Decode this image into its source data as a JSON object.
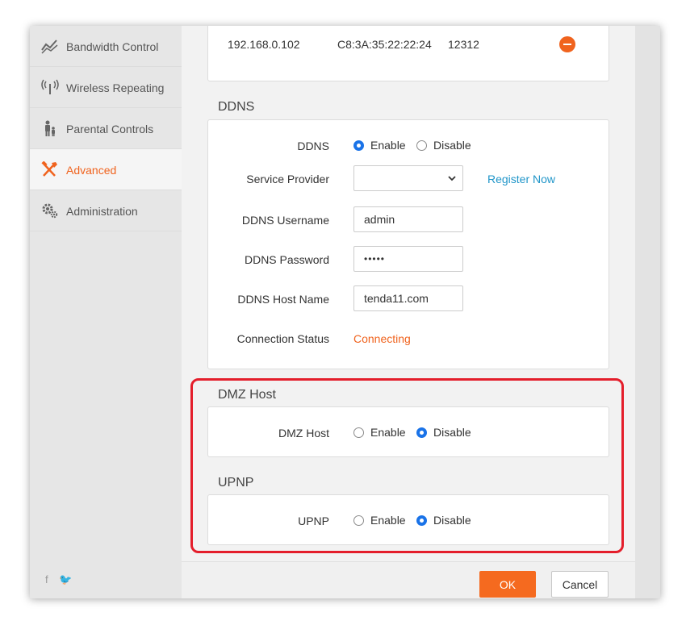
{
  "sidebar": {
    "items": [
      {
        "label": "Bandwidth Control",
        "icon": "chart-line-icon"
      },
      {
        "label": "Wireless Repeating",
        "icon": "wireless-signal-icon"
      },
      {
        "label": "Parental Controls",
        "icon": "parent-child-icon"
      },
      {
        "label": "Advanced",
        "icon": "tools-icon",
        "active": true
      },
      {
        "label": "Administration",
        "icon": "gears-icon"
      }
    ],
    "social": "f 🐦"
  },
  "top_table": {
    "row": {
      "ip": "192.168.0.102",
      "mac": "C8:3A:35:22:22:24",
      "port": "12312",
      "action_icon": "remove-icon"
    }
  },
  "ddns": {
    "title": "DDNS",
    "ddns_label": "DDNS",
    "enable_label": "Enable",
    "disable_label": "Disable",
    "enabled": true,
    "service_provider_label": "Service Provider",
    "service_provider_value": "",
    "register_link": "Register Now",
    "username_label": "DDNS Username",
    "username_value": "admin",
    "password_label": "DDNS Password",
    "password_value": "•••••",
    "host_label": "DDNS Host Name",
    "host_value": "tenda11.com",
    "status_label": "Connection Status",
    "status_value": "Connecting"
  },
  "dmz": {
    "title": "DMZ Host",
    "label": "DMZ Host",
    "enable_label": "Enable",
    "disable_label": "Disable",
    "enabled": false
  },
  "upnp": {
    "title": "UPNP",
    "label": "UPNP",
    "enable_label": "Enable",
    "disable_label": "Disable",
    "enabled": false
  },
  "footer": {
    "ok_label": "OK",
    "cancel_label": "Cancel"
  },
  "colors": {
    "accent": "#f0631e",
    "link": "#2196c9",
    "radio_on": "#1a73e8",
    "highlight": "#e41e2b"
  }
}
